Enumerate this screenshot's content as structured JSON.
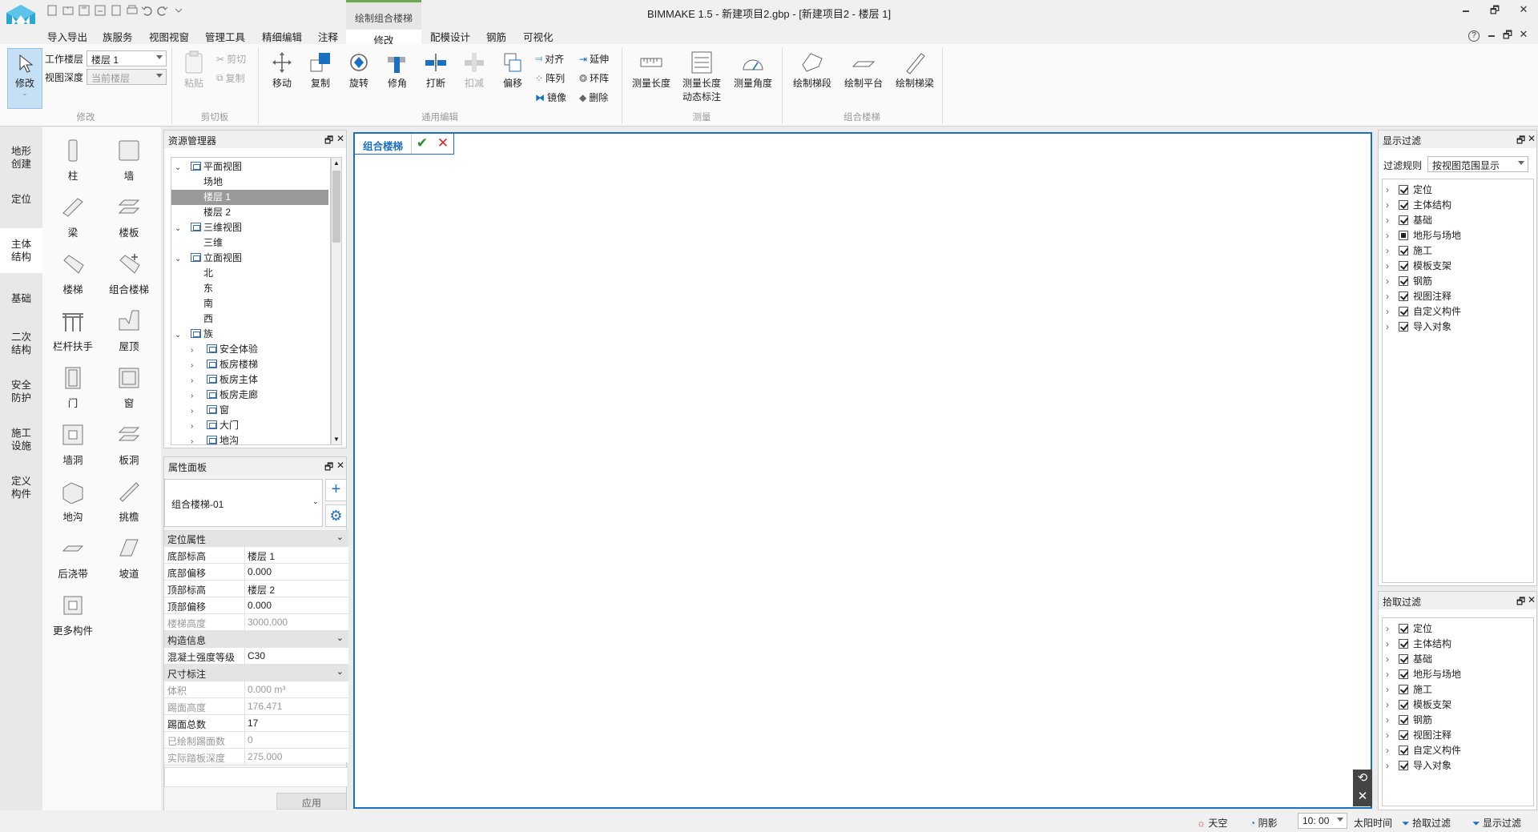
{
  "window": {
    "title": "BIMMAKE 1.5 - 新建项目2.gbp - [新建项目2 - 楼层 1]",
    "min_label": "🗕",
    "max_label": "🗗",
    "close_label": "✕"
  },
  "menu": {
    "items": [
      "导入导出",
      "族服务",
      "视图视窗",
      "管理工具",
      "精细编辑",
      "注释",
      "修改",
      "配模设计",
      "钢筋",
      "可视化"
    ],
    "context_title": "绘制组合楼梯",
    "active": "修改",
    "help_label": "?",
    "sub_min": "🗕",
    "sub_max": "🗗",
    "sub_close": "✕"
  },
  "ribbon": {
    "modify": {
      "select_label": "修改",
      "work_floor_label": "工作楼层",
      "work_floor_value": "楼层 1",
      "view_depth_label": "视图深度",
      "view_depth_value": "当前楼层",
      "group": "修改"
    },
    "clipboard": {
      "paste": "粘贴",
      "cut": "剪切",
      "copy": "复制",
      "group": "剪切板"
    },
    "edit": {
      "move": "移动",
      "duplicate": "复制",
      "rotate": "旋转",
      "trim": "修角",
      "break": "打断",
      "subtract": "扣减",
      "offset": "偏移",
      "align": "对齐",
      "extend": "延伸",
      "array": "阵列",
      "ring_array": "环阵",
      "mirror": "镜像",
      "delete": "删除",
      "group": "通用编辑"
    },
    "measure": {
      "length": "测量长度",
      "dynamic_line1": "测量长度",
      "dynamic_line2": "动态标注",
      "angle": "测量角度",
      "group": "测量"
    },
    "stairs": {
      "segment": "绘制梯段",
      "platform": "绘制平台",
      "beam": "绘制梯梁",
      "group": "组合楼梯"
    }
  },
  "side_tabs": [
    "地形\n创建",
    "定位",
    "主体\n结构",
    "基础",
    "二次\n结构",
    "安全\n防护",
    "施工\n设施",
    "定义\n构件"
  ],
  "components": [
    "柱",
    "墙",
    "梁",
    "楼板",
    "楼梯",
    "组合楼梯",
    "栏杆扶手",
    "屋顶",
    "门",
    "窗",
    "墙洞",
    "板洞",
    "地沟",
    "挑檐",
    "后浇带",
    "坡道",
    "更多构件"
  ],
  "resource_manager": {
    "title": "资源管理器",
    "tree": [
      {
        "label": "平面视图",
        "level": 0,
        "arrow": "⌄",
        "icon": "view"
      },
      {
        "label": "场地",
        "level": 1
      },
      {
        "label": "楼层 1",
        "level": 1,
        "selected": true
      },
      {
        "label": "楼层 2",
        "level": 1
      },
      {
        "label": "三维视图",
        "level": 0,
        "arrow": "⌄",
        "icon": "view"
      },
      {
        "label": "三维",
        "level": 1
      },
      {
        "label": "立面视图",
        "level": 0,
        "arrow": "⌄",
        "icon": "view"
      },
      {
        "label": "北",
        "level": 1
      },
      {
        "label": "东",
        "level": 1
      },
      {
        "label": "南",
        "level": 1
      },
      {
        "label": "西",
        "level": 1
      },
      {
        "label": "族",
        "level": 0,
        "arrow": "⌄",
        "icon": "family"
      },
      {
        "label": "安全体验",
        "level": 2,
        "arrow": "›",
        "icon": "family"
      },
      {
        "label": "板房楼梯",
        "level": 2,
        "arrow": "›",
        "icon": "family"
      },
      {
        "label": "板房主体",
        "level": 2,
        "arrow": "›",
        "icon": "family"
      },
      {
        "label": "板房走廊",
        "level": 2,
        "arrow": "›",
        "icon": "family"
      },
      {
        "label": "窗",
        "level": 2,
        "arrow": "›",
        "icon": "family"
      },
      {
        "label": "大门",
        "level": 2,
        "arrow": "›",
        "icon": "family"
      },
      {
        "label": "地沟",
        "level": 2,
        "arrow": "›",
        "icon": "family"
      }
    ]
  },
  "properties": {
    "title": "属性面板",
    "type_value": "组合楼梯-01",
    "sections": [
      {
        "title": "定位属性",
        "rows": [
          {
            "k": "底部标高",
            "v": "楼层 1",
            "ro": false
          },
          {
            "k": "底部偏移",
            "v": "0.000",
            "ro": false
          },
          {
            "k": "顶部标高",
            "v": "楼层 2",
            "ro": false
          },
          {
            "k": "顶部偏移",
            "v": "0.000",
            "ro": false
          },
          {
            "k": "楼梯高度",
            "v": "3000.000",
            "ro": true
          }
        ]
      },
      {
        "title": "构造信息",
        "rows": [
          {
            "k": "混凝土强度等级",
            "v": "C30",
            "ro": false
          }
        ]
      },
      {
        "title": "尺寸标注",
        "rows": [
          {
            "k": "体积",
            "v": "0.000 m³",
            "ro": true
          },
          {
            "k": "踢面高度",
            "v": "176.471",
            "ro": true
          },
          {
            "k": "踢面总数",
            "v": "17",
            "ro": false
          },
          {
            "k": "已绘制踢面数",
            "v": "0",
            "ro": true
          },
          {
            "k": "实际踏板深度",
            "v": "275.000",
            "ro": true
          }
        ]
      }
    ],
    "apply": "应用"
  },
  "canvas": {
    "tab_label": "组合楼梯"
  },
  "display_filter": {
    "title": "显示过滤",
    "rule_label": "过滤规则",
    "rule_value": "按视图范围显示",
    "items": [
      {
        "label": "定位",
        "state": "on"
      },
      {
        "label": "主体结构",
        "state": "on"
      },
      {
        "label": "基础",
        "state": "on"
      },
      {
        "label": "地形与场地",
        "state": "part"
      },
      {
        "label": "施工",
        "state": "on"
      },
      {
        "label": "模板支架",
        "state": "on"
      },
      {
        "label": "钢筋",
        "state": "on"
      },
      {
        "label": "视图注释",
        "state": "on"
      },
      {
        "label": "自定义构件",
        "state": "on"
      },
      {
        "label": "导入对象",
        "state": "on"
      }
    ]
  },
  "pick_filter": {
    "title": "拾取过滤",
    "items": [
      {
        "label": "定位",
        "state": "on"
      },
      {
        "label": "主体结构",
        "state": "on"
      },
      {
        "label": "基础",
        "state": "on"
      },
      {
        "label": "地形与场地",
        "state": "on"
      },
      {
        "label": "施工",
        "state": "on"
      },
      {
        "label": "模板支架",
        "state": "on"
      },
      {
        "label": "钢筋",
        "state": "on"
      },
      {
        "label": "视图注释",
        "state": "on"
      },
      {
        "label": "自定义构件",
        "state": "on"
      },
      {
        "label": "导入对象",
        "state": "on"
      }
    ]
  },
  "status": {
    "sky": "天空",
    "shadow": "阴影",
    "time_value": "10: 00",
    "sun_time": "太阳时间",
    "pick_filter": "拾取过滤",
    "display_filter": "显示过滤"
  },
  "colors": {
    "accent": "#1b6fc1",
    "ctx_green": "#6aa84f",
    "check_green": "#2e8b2e",
    "cancel_red": "#d0282e"
  }
}
